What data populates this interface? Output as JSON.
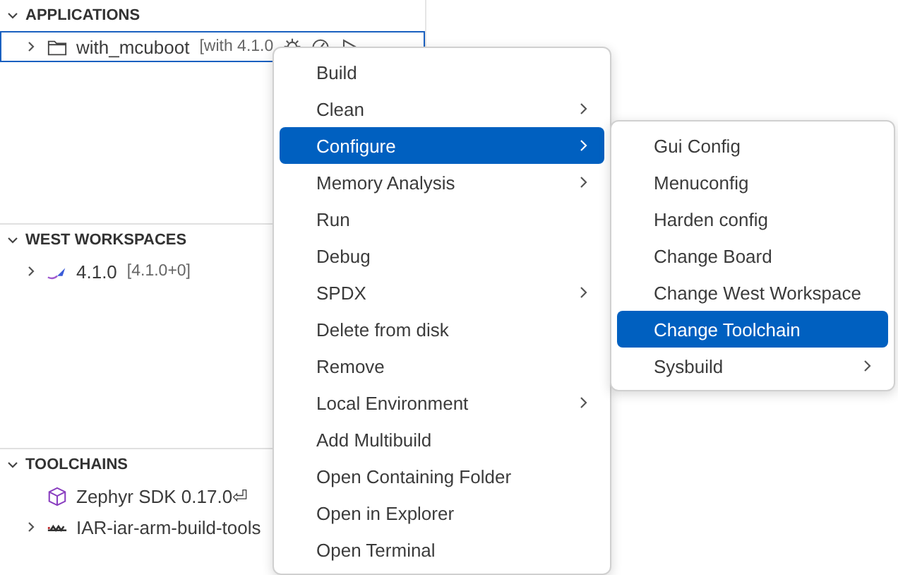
{
  "sections": [
    {
      "title": "APPLICATIONS",
      "expanded": true,
      "items": [
        {
          "kind": "app",
          "label": "with_mcuboot",
          "detail": "[with 4.1.0",
          "expanded": false,
          "selected": true
        }
      ]
    },
    {
      "title": "WEST WORKSPACES",
      "expanded": true,
      "items": [
        {
          "kind": "workspace",
          "label": "4.1.0",
          "detail": "[4.1.0+0]",
          "expanded": false,
          "selected": false
        }
      ]
    },
    {
      "title": "TOOLCHAINS",
      "expanded": true,
      "items": [
        {
          "kind": "sdk",
          "label": "Zephyr SDK 0.17.0⏎",
          "selected": false
        },
        {
          "kind": "iar",
          "label": "IAR-iar-arm-build-tools",
          "expanded": false,
          "selected": false
        }
      ]
    }
  ],
  "context_menu": [
    {
      "label": "Build",
      "submenu": false,
      "selected": false
    },
    {
      "label": "Clean",
      "submenu": true,
      "selected": false
    },
    {
      "label": "Configure",
      "submenu": true,
      "selected": true
    },
    {
      "label": "Memory Analysis",
      "submenu": true,
      "selected": false
    },
    {
      "label": "Run",
      "submenu": false,
      "selected": false
    },
    {
      "label": "Debug",
      "submenu": false,
      "selected": false
    },
    {
      "label": "SPDX",
      "submenu": true,
      "selected": false
    },
    {
      "label": "Delete from disk",
      "submenu": false,
      "selected": false
    },
    {
      "label": "Remove",
      "submenu": false,
      "selected": false
    },
    {
      "label": "Local Environment",
      "submenu": true,
      "selected": false
    },
    {
      "label": "Add Multibuild",
      "submenu": false,
      "selected": false
    },
    {
      "label": "Open Containing Folder",
      "submenu": false,
      "selected": false
    },
    {
      "label": "Open in Explorer",
      "submenu": false,
      "selected": false
    },
    {
      "label": "Open Terminal",
      "submenu": false,
      "selected": false
    }
  ],
  "submenu": [
    {
      "label": "Gui Config",
      "submenu": false,
      "selected": false
    },
    {
      "label": "Menuconfig",
      "submenu": false,
      "selected": false
    },
    {
      "label": "Harden config",
      "submenu": false,
      "selected": false
    },
    {
      "label": "Change Board",
      "submenu": false,
      "selected": false
    },
    {
      "label": "Change West Workspace",
      "submenu": false,
      "selected": false
    },
    {
      "label": "Change Toolchain",
      "submenu": false,
      "selected": true
    },
    {
      "label": "Sysbuild",
      "submenu": true,
      "selected": false
    }
  ]
}
